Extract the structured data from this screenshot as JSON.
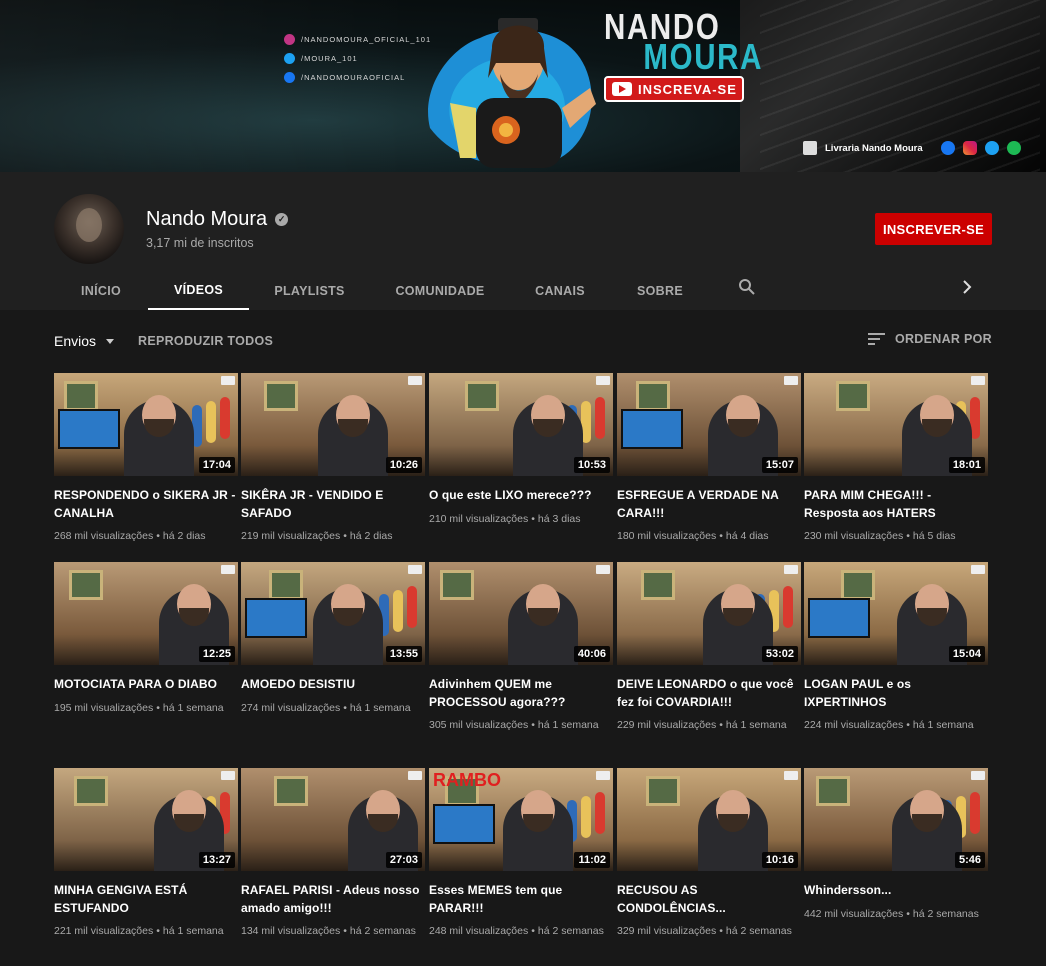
{
  "banner": {
    "social_handles": [
      "/NANDOMOURA_OFICIAL_101",
      "/MOURA_101",
      "/NANDOMOURAOFICIAL"
    ],
    "logo_line1": "NANDO",
    "logo_line2": "MOURA",
    "subscribe_badge": "INSCREVA-SE",
    "store_link": "Livraria Nando Moura",
    "colors": {
      "accent_cyan": "#2bb9c9",
      "badge_red": "#d21a1a"
    }
  },
  "channel": {
    "name": "Nando Moura",
    "subscribers": "3,17 mi de inscritos",
    "subscribe_label": "INSCREVER-SE"
  },
  "tabs": [
    {
      "label": "INÍCIO",
      "active": false
    },
    {
      "label": "VÍDEOS",
      "active": true
    },
    {
      "label": "PLAYLISTS",
      "active": false
    },
    {
      "label": "COMUNIDADE",
      "active": false
    },
    {
      "label": "CANAIS",
      "active": false
    },
    {
      "label": "SOBRE",
      "active": false
    }
  ],
  "toolbar": {
    "filter_label": "Envios",
    "play_all_label": "REPRODUZIR TODOS",
    "sort_label": "ORDENAR POR"
  },
  "videos": [
    {
      "title": "RESPONDENDO o SIKERA JR - CANALHA",
      "views": "268 mil visualizações",
      "age": "há 2 dias",
      "duration": "17:04"
    },
    {
      "title": "SIKÊRA JR - VENDIDO E SAFADO",
      "views": "219 mil visualizações",
      "age": "há 2 dias",
      "duration": "10:26"
    },
    {
      "title": "O que este LIXO merece???",
      "views": "210 mil visualizações",
      "age": "há 3 dias",
      "duration": "10:53"
    },
    {
      "title": "ESFREGUE A VERDADE NA CARA!!!",
      "views": "180 mil visualizações",
      "age": "há 4 dias",
      "duration": "15:07"
    },
    {
      "title": "PARA MIM CHEGA!!! - Resposta aos HATERS",
      "views": "230 mil visualizações",
      "age": "há 5 dias",
      "duration": "18:01"
    },
    {
      "title": "MOTOCIATA PARA O DIABO",
      "views": "195 mil visualizações",
      "age": "há 1 semana",
      "duration": "12:25"
    },
    {
      "title": "AMOEDO DESISTIU",
      "views": "274 mil visualizações",
      "age": "há 1 semana",
      "duration": "13:55"
    },
    {
      "title": "Adivinhem QUEM me PROCESSOU agora???",
      "views": "305 mil visualizações",
      "age": "há 1 semana",
      "duration": "40:06"
    },
    {
      "title": "DEIVE LEONARDO o que você fez foi COVARDIA!!!",
      "views": "229 mil visualizações",
      "age": "há 1 semana",
      "duration": "53:02"
    },
    {
      "title": "LOGAN PAUL e os IXPERTINHOS",
      "views": "224 mil visualizações",
      "age": "há 1 semana",
      "duration": "15:04"
    },
    {
      "title": "MINHA GENGIVA ESTÁ ESTUFANDO",
      "views": "221 mil visualizações",
      "age": "há 1 semana",
      "duration": "13:27"
    },
    {
      "title": "RAFAEL PARISI - Adeus nosso amado amigo!!!",
      "views": "134 mil visualizações",
      "age": "há 2 semanas",
      "duration": "27:03"
    },
    {
      "title": "Esses MEMES tem que PARAR!!!",
      "views": "248 mil visualizações",
      "age": "há 2 semanas",
      "duration": "11:02"
    },
    {
      "title": "RECUSOU AS CONDOLÊNCIAS...",
      "views": "329 mil visualizações",
      "age": "há 2 semanas",
      "duration": "10:16"
    },
    {
      "title": "Whindersson...",
      "views": "442 mil visualizações",
      "age": "há 2 semanas",
      "duration": "5:46"
    }
  ],
  "thumb_texts": {
    "rambo": "RAMBO"
  }
}
